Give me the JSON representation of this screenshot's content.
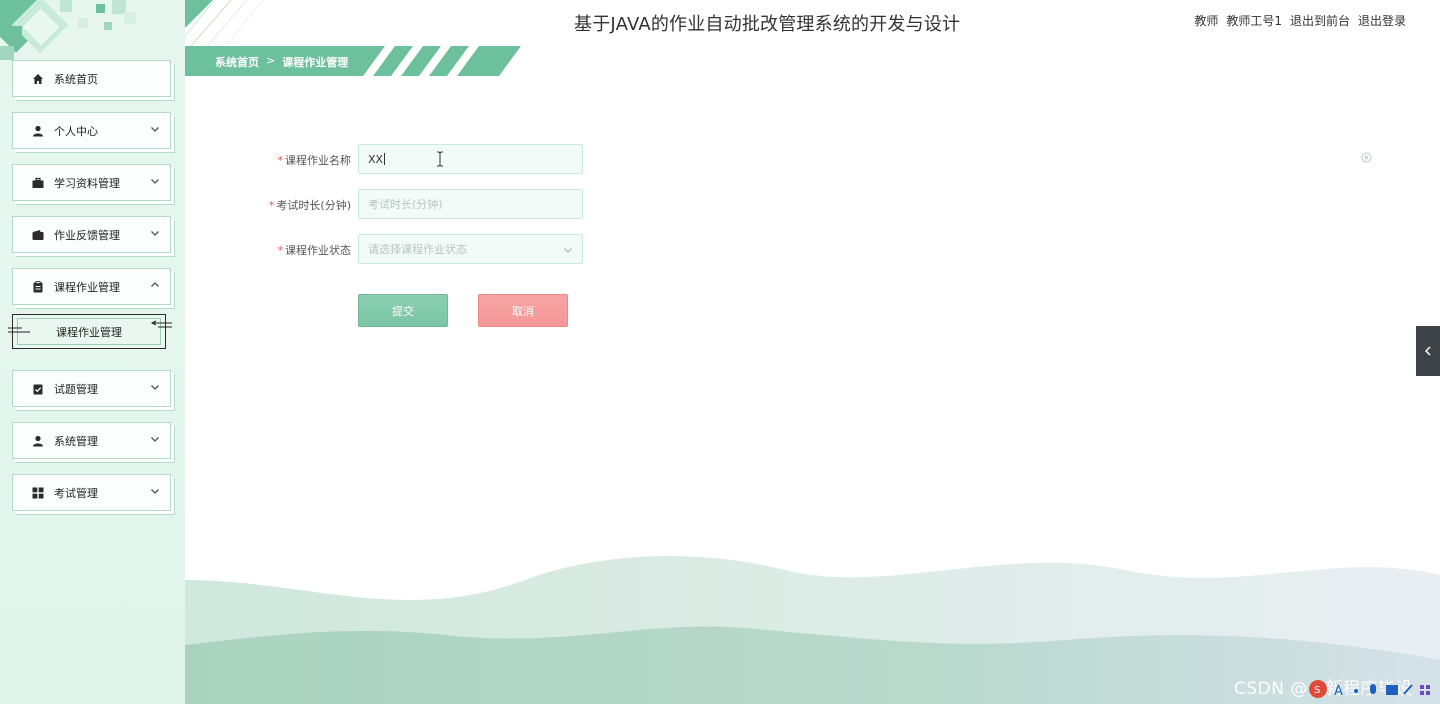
{
  "header": {
    "title": "基于JAVA的作业自动批改管理系统的开发与设计",
    "user_role": "教师",
    "user_name": "教师工号1",
    "front_link": "退出到前台",
    "logout_link": "退出登录"
  },
  "breadcrumb": {
    "home": "系统首页",
    "separator": ">",
    "current": "课程作业管理"
  },
  "sidebar": {
    "items": [
      {
        "label": "系统首页",
        "icon": "home-icon",
        "expandable": false
      },
      {
        "label": "个人中心",
        "icon": "user-icon",
        "expandable": true
      },
      {
        "label": "学习资料管理",
        "icon": "briefcase-icon",
        "expandable": true
      },
      {
        "label": "作业反馈管理",
        "icon": "wallet-icon",
        "expandable": true
      },
      {
        "label": "课程作业管理",
        "icon": "clipboard-icon",
        "expandable": true,
        "expanded": true
      },
      {
        "label": "试题管理",
        "icon": "checklist-icon",
        "expandable": true
      },
      {
        "label": "系统管理",
        "icon": "user-icon",
        "expandable": true
      },
      {
        "label": "考试管理",
        "icon": "grid-icon",
        "expandable": true
      }
    ],
    "subitem": {
      "label": "课程作业管理"
    }
  },
  "form": {
    "name": {
      "label": "课程作业名称",
      "value": "XX",
      "required": true
    },
    "duration": {
      "label": "考试时长(分钟)",
      "placeholder": "考试时长(分钟)",
      "value": "",
      "required": true
    },
    "status": {
      "label": "课程作业状态",
      "placeholder": "请选择课程作业状态",
      "value": "",
      "required": true
    },
    "submit_label": "提交",
    "cancel_label": "取消"
  },
  "watermark": "CSDN @会新程序毕设",
  "colors": {
    "primary": "#7bc4a5",
    "breadcrumb_bg": "#6cc09b",
    "cancel": "#f59797",
    "sidebar_bg": "#e3f6ee",
    "toggle_bg": "#3d4346"
  }
}
